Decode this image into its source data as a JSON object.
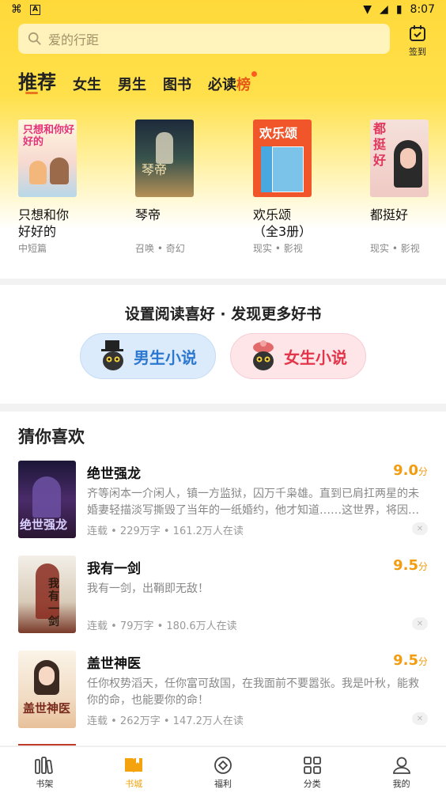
{
  "status": {
    "time": "8:07"
  },
  "search": {
    "placeholder": "爱的行距"
  },
  "signin": {
    "label": "签到"
  },
  "tabs": [
    {
      "label": "推荐",
      "active": true
    },
    {
      "label": "女生"
    },
    {
      "label": "男生"
    },
    {
      "label": "图书"
    },
    {
      "label_main": "必读",
      "label_hi": "榜",
      "badge_dot": true
    }
  ],
  "featured": [
    {
      "title": "只想和你\n好好的",
      "meta": "中短篇",
      "cover_text": "只想和你好好的"
    },
    {
      "title": "琴帝",
      "meta": "召唤 • 奇幻",
      "cover_text": "琴帝"
    },
    {
      "title": "欢乐颂\n（全3册）",
      "meta": "现实 • 影视",
      "cover_text": "欢乐颂"
    },
    {
      "title": "都挺好",
      "meta": "现实 • 影视",
      "cover_text": "都挺好"
    }
  ],
  "preference": {
    "heading": "设置阅读喜好 · 发现更多好书",
    "male_label": "男生小说",
    "female_label": "女生小说"
  },
  "guess": {
    "heading": "猜你喜欢",
    "items": [
      {
        "title": "绝世强龙",
        "score": "9.0",
        "unit": "分",
        "desc": "齐等闲本一介闲人，镇一方监狱，囚万千枭雄。直到已肩扛两星的未婚妻轻描淡写撕毁了当年的一纸婚约，他才知道……这世界，将因…",
        "meta": "连载 • 229万字 • 161.2万人在读"
      },
      {
        "title": "我有一剑",
        "score": "9.5",
        "unit": "分",
        "desc": "我有一剑，出鞘即无敌！",
        "meta": "连载 • 79万字 • 180.6万人在读"
      },
      {
        "title": "盖世神医",
        "score": "9.5",
        "unit": "分",
        "desc": "任你权势滔天，任你富可敌国，在我面前不要嚣张。我是叶秋，能救你的命，也能要你的命！",
        "meta": "连载 • 262万字 • 147.2万人在读"
      }
    ]
  },
  "nav": [
    {
      "label": "书架",
      "icon": "bookshelf-icon"
    },
    {
      "label": "书城",
      "icon": "bookstore-icon",
      "active": true
    },
    {
      "label": "福利",
      "icon": "welfare-icon"
    },
    {
      "label": "分类",
      "icon": "category-icon"
    },
    {
      "label": "我的",
      "icon": "profile-icon"
    }
  ],
  "colors": {
    "brand": "#ffd93a",
    "accent": "#f29c0f",
    "male": "#2c77d0",
    "female": "#e33549"
  }
}
